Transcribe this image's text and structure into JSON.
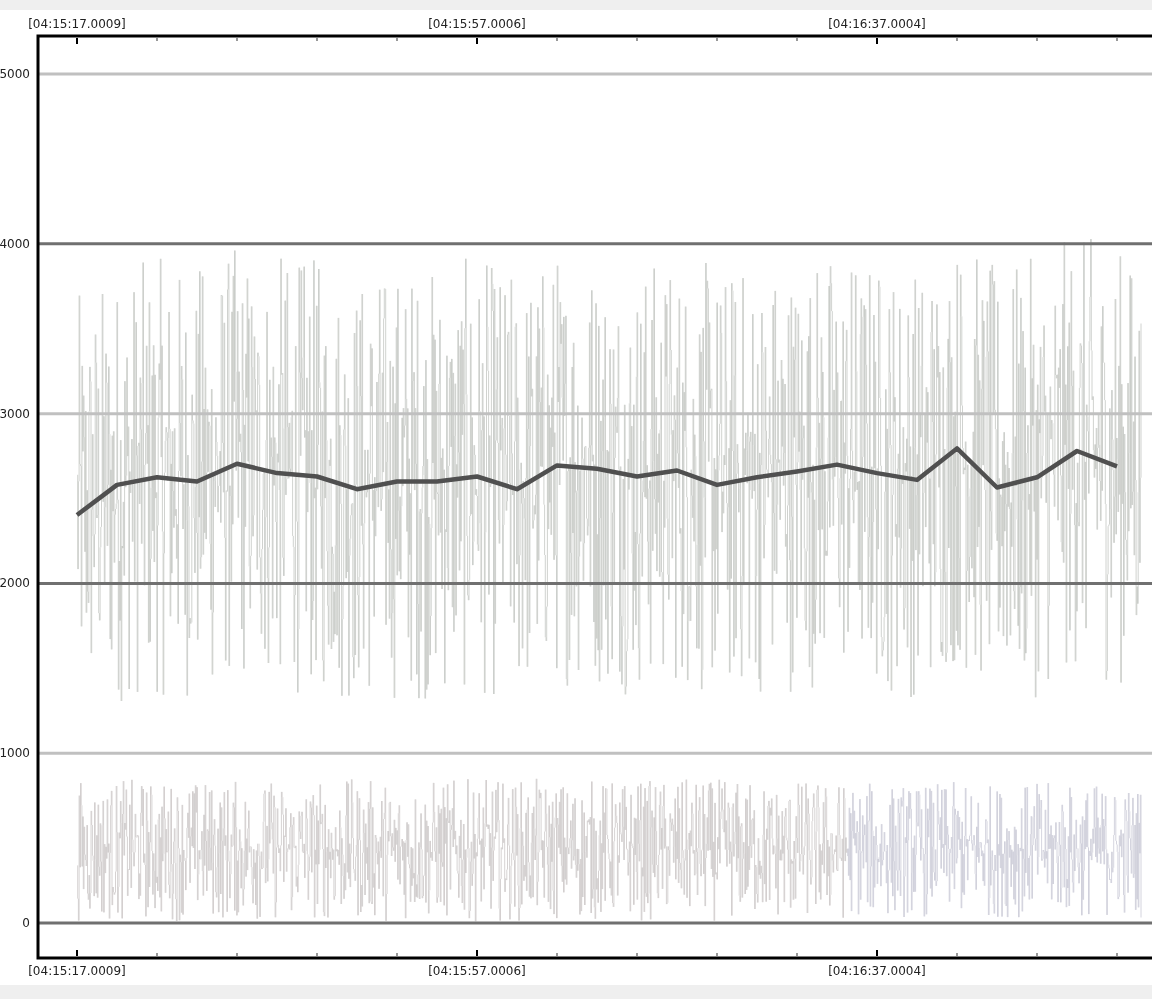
{
  "plot": {
    "top_axis_labels": [
      "[04:15:17.0009]",
      "[04:15:57.0006]",
      "[04:16:37.0004]"
    ],
    "chart_data": {
      "type": "line",
      "categories": [
        "[04:15:17.0009]",
        null,
        null,
        null,
        null,
        null,
        null,
        null,
        null,
        null,
        "[04:15:57.0006]",
        null,
        null,
        null,
        null,
        null,
        null,
        null,
        null,
        null,
        "[04:16:37.0004]",
        null,
        null,
        null,
        null,
        null,
        null
      ],
      "series": [
        {
          "color": "#505050",
          "values": [
            2403,
            2580,
            2625,
            2600,
            2705,
            2650,
            2630,
            2555,
            2600,
            2600,
            2630,
            2555,
            2695,
            2675,
            2630,
            2665,
            2580,
            2625,
            2660,
            2700,
            2650,
            2610,
            2795,
            2565,
            2625,
            2780,
            2690
          ]
        }
      ],
      "ylim": [
        -206,
        5224
      ],
      "grid": true,
      "yticks": [
        0,
        1000,
        2000,
        3000,
        4000,
        5000
      ]
    }
  }
}
